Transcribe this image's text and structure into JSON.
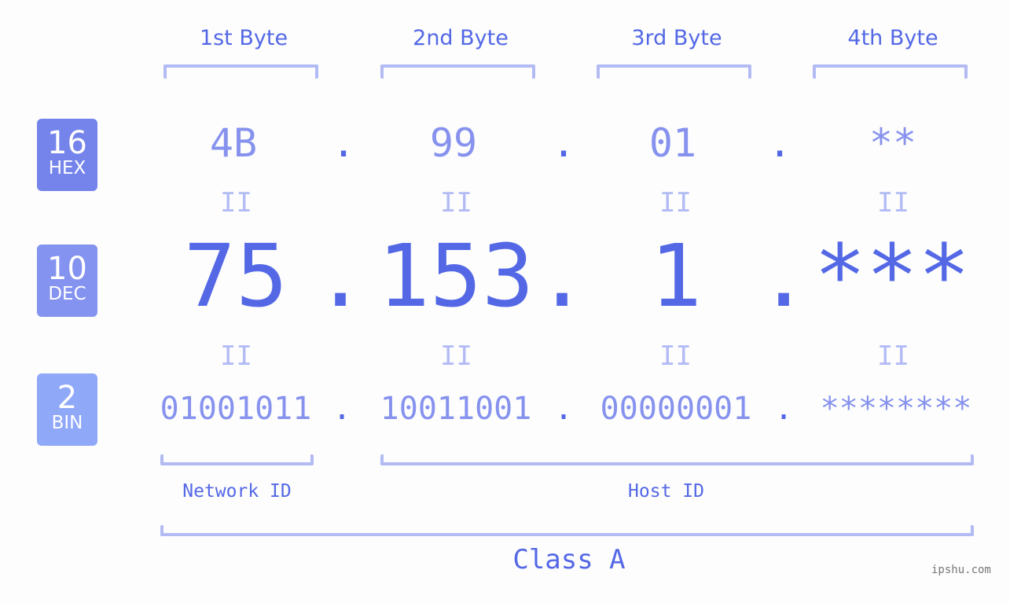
{
  "bytes": {
    "labels": [
      "1st Byte",
      "2nd Byte",
      "3rd Byte",
      "4th Byte"
    ]
  },
  "badges": {
    "hex": {
      "num": "16",
      "label": "HEX",
      "color": "#7584eb"
    },
    "dec": {
      "num": "10",
      "label": "DEC",
      "color": "#8492f0"
    },
    "bin": {
      "num": "2",
      "label": "BIN",
      "color": "#8fa8f8"
    }
  },
  "hex": {
    "values": [
      "4B",
      "99",
      "01",
      "**"
    ],
    "separator": "."
  },
  "dec": {
    "values": [
      "75",
      "153",
      "1",
      "***"
    ],
    "separator": "."
  },
  "bin": {
    "values": [
      "01001011",
      "10011001",
      "00000001",
      "********"
    ],
    "separator": "."
  },
  "equals": "II",
  "ids": {
    "network": "Network ID",
    "host": "Host ID"
  },
  "class_label": "Class A",
  "watermark": "ipshu.com",
  "colors": {
    "accent": "#5468e6",
    "light": "#8692ee",
    "bracket": "#b3bbf5"
  }
}
